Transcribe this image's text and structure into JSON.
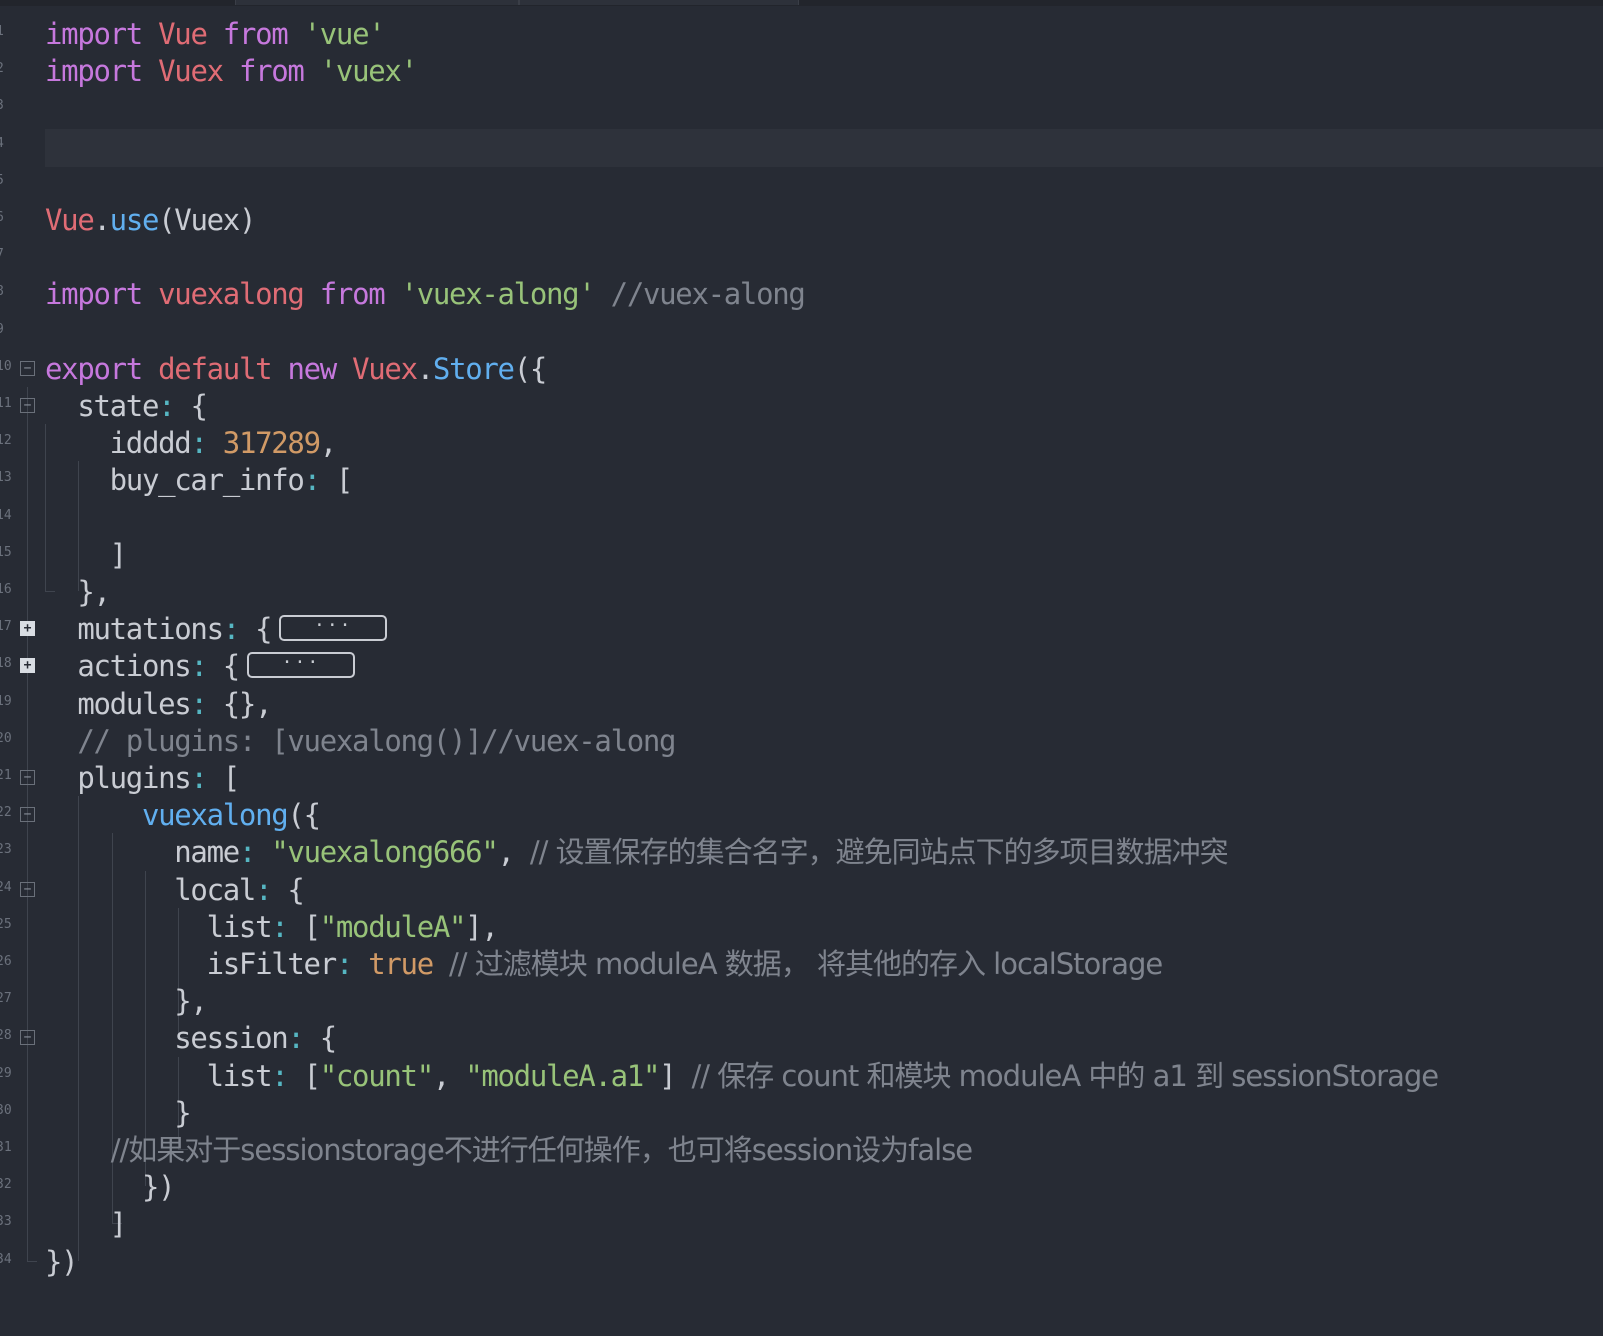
{
  "editor": {
    "language": "javascript",
    "current_line": 4
  },
  "lines": [
    {
      "n": "1",
      "fold": "",
      "tokens": [
        [
          "kw",
          "import"
        ],
        [
          "pl",
          " "
        ],
        [
          "id",
          "Vue"
        ],
        [
          "pl",
          " "
        ],
        [
          "kw",
          "from"
        ],
        [
          "pl",
          " "
        ],
        [
          "str",
          "'vue'"
        ]
      ]
    },
    {
      "n": "2",
      "fold": "",
      "tokens": [
        [
          "kw",
          "import"
        ],
        [
          "pl",
          " "
        ],
        [
          "id",
          "Vuex"
        ],
        [
          "pl",
          " "
        ],
        [
          "kw",
          "from"
        ],
        [
          "pl",
          " "
        ],
        [
          "str",
          "'vuex'"
        ]
      ]
    },
    {
      "n": "3",
      "fold": "",
      "tokens": []
    },
    {
      "n": "4",
      "fold": "",
      "tokens": []
    },
    {
      "n": "5",
      "fold": "",
      "tokens": []
    },
    {
      "n": "6",
      "fold": "",
      "tokens": [
        [
          "id",
          "Vue"
        ],
        [
          "pl",
          "."
        ],
        [
          "fn",
          "use"
        ],
        [
          "pl",
          "(Vuex)"
        ]
      ]
    },
    {
      "n": "7",
      "fold": "",
      "tokens": []
    },
    {
      "n": "8",
      "fold": "",
      "tokens": [
        [
          "kw",
          "import"
        ],
        [
          "pl",
          " "
        ],
        [
          "id",
          "vuexalong"
        ],
        [
          "pl",
          " "
        ],
        [
          "kw",
          "from"
        ],
        [
          "pl",
          " "
        ],
        [
          "str",
          "'vuex-along'"
        ],
        [
          "pl",
          " "
        ],
        [
          "cm",
          "//vuex-along"
        ]
      ]
    },
    {
      "n": "9",
      "fold": "",
      "tokens": []
    },
    {
      "n": "10",
      "fold": "minus",
      "tokens": [
        [
          "kw",
          "export"
        ],
        [
          "pl",
          " "
        ],
        [
          "id",
          "default"
        ],
        [
          "pl",
          " "
        ],
        [
          "kw",
          "new"
        ],
        [
          "pl",
          " "
        ],
        [
          "id",
          "Vuex"
        ],
        [
          "pl",
          "."
        ],
        [
          "fn",
          "Store"
        ],
        [
          "pl",
          "({"
        ]
      ]
    },
    {
      "n": "11",
      "fold": "minus",
      "tokens": [
        [
          "pl",
          "  state"
        ],
        [
          "op",
          ":"
        ],
        [
          "pl",
          " {"
        ]
      ]
    },
    {
      "n": "12",
      "fold": "",
      "tokens": [
        [
          "pl",
          "    idddd"
        ],
        [
          "op",
          ":"
        ],
        [
          "pl",
          " "
        ],
        [
          "num",
          "317289"
        ],
        [
          "pl",
          ","
        ]
      ]
    },
    {
      "n": "13",
      "fold": "",
      "tokens": [
        [
          "pl",
          "    buy_car_info"
        ],
        [
          "op",
          ":"
        ],
        [
          "pl",
          " ["
        ]
      ]
    },
    {
      "n": "14",
      "fold": "",
      "tokens": []
    },
    {
      "n": "15",
      "fold": "",
      "tokens": [
        [
          "pl",
          "    ]"
        ]
      ]
    },
    {
      "n": "16",
      "fold": "",
      "tokens": [
        [
          "pl",
          "  },"
        ]
      ]
    },
    {
      "n": "17",
      "fold": "plus",
      "tokens": [
        [
          "pl",
          "  mutations"
        ],
        [
          "op",
          ":"
        ],
        [
          "pl",
          " {"
        ],
        [
          "ellipsis",
          "···"
        ]
      ]
    },
    {
      "n": "18",
      "fold": "plus",
      "tokens": [
        [
          "pl",
          "  actions"
        ],
        [
          "op",
          ":"
        ],
        [
          "pl",
          " {"
        ],
        [
          "ellipsis",
          "···"
        ]
      ]
    },
    {
      "n": "19",
      "fold": "",
      "tokens": [
        [
          "pl",
          "  modules"
        ],
        [
          "op",
          ":"
        ],
        [
          "pl",
          " {},"
        ]
      ]
    },
    {
      "n": "20",
      "fold": "",
      "tokens": [
        [
          "cm",
          "  // plugins: [vuexalong()]//vuex-along"
        ]
      ]
    },
    {
      "n": "21",
      "fold": "minus",
      "tokens": [
        [
          "pl",
          "  plugins"
        ],
        [
          "op",
          ":"
        ],
        [
          "pl",
          " ["
        ]
      ]
    },
    {
      "n": "22",
      "fold": "minus",
      "tokens": [
        [
          "pl",
          "      "
        ],
        [
          "fn",
          "vuexalong"
        ],
        [
          "pl",
          "({"
        ]
      ]
    },
    {
      "n": "23",
      "fold": "",
      "tokens": [
        [
          "pl",
          "        name"
        ],
        [
          "op",
          ":"
        ],
        [
          "pl",
          " "
        ],
        [
          "str",
          "\"vuexalong666\""
        ],
        [
          "pl",
          ", "
        ],
        [
          "cm",
          "// 设置保存的集合名字，避免同站点下的多项目数据冲突"
        ]
      ]
    },
    {
      "n": "24",
      "fold": "minus",
      "tokens": [
        [
          "pl",
          "        local"
        ],
        [
          "op",
          ":"
        ],
        [
          "pl",
          " {"
        ]
      ]
    },
    {
      "n": "25",
      "fold": "",
      "tokens": [
        [
          "pl",
          "          list"
        ],
        [
          "op",
          ":"
        ],
        [
          "pl",
          " ["
        ],
        [
          "str",
          "\"moduleA\""
        ],
        [
          "pl",
          "],"
        ]
      ]
    },
    {
      "n": "26",
      "fold": "",
      "tokens": [
        [
          "pl",
          "          isFilter"
        ],
        [
          "op",
          ":"
        ],
        [
          "pl",
          " "
        ],
        [
          "num",
          "true"
        ],
        [
          "pl",
          " "
        ],
        [
          "cm",
          "// 过滤模块 moduleA 数据， 将其他的存入 localStorage"
        ]
      ]
    },
    {
      "n": "27",
      "fold": "",
      "tokens": [
        [
          "pl",
          "        },"
        ]
      ]
    },
    {
      "n": "28",
      "fold": "minus",
      "tokens": [
        [
          "pl",
          "        session"
        ],
        [
          "op",
          ":"
        ],
        [
          "pl",
          " {"
        ]
      ]
    },
    {
      "n": "29",
      "fold": "",
      "tokens": [
        [
          "pl",
          "          list"
        ],
        [
          "op",
          ":"
        ],
        [
          "pl",
          " ["
        ],
        [
          "str",
          "\"count\""
        ],
        [
          "pl",
          ", "
        ],
        [
          "str",
          "\"moduleA.a1\""
        ],
        [
          "pl",
          "] "
        ],
        [
          "cm",
          "// 保存 count 和模块 moduleA 中的 a1 到 sessionStorage"
        ]
      ]
    },
    {
      "n": "30",
      "fold": "",
      "tokens": [
        [
          "pl",
          "        }"
        ]
      ]
    },
    {
      "n": "31",
      "fold": "",
      "tokens": [
        [
          "cm",
          "        //如果对于sessionstorage不进行任何操作，也可将session设为false"
        ]
      ]
    },
    {
      "n": "32",
      "fold": "",
      "tokens": [
        [
          "pl",
          "      })"
        ]
      ]
    },
    {
      "n": "33",
      "fold": "",
      "tokens": [
        [
          "pl",
          "    ]"
        ]
      ]
    },
    {
      "n": "34",
      "fold": "",
      "tokens": [
        [
          "pl",
          "})"
        ]
      ]
    }
  ]
}
